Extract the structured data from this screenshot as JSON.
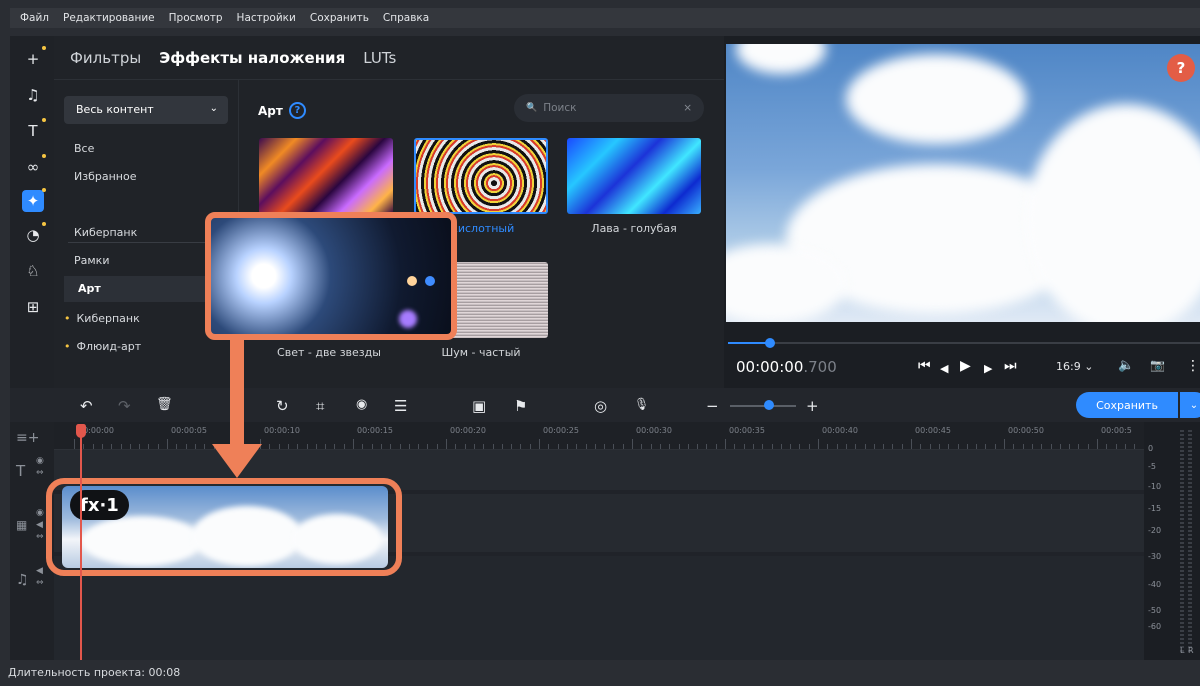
{
  "menu": [
    "Файл",
    "Редактирование",
    "Просмотр",
    "Настройки",
    "Сохранить",
    "Справка"
  ],
  "tools": [
    {
      "icon": "plus-icon",
      "glyph": "+"
    },
    {
      "icon": "music-icon",
      "glyph": "♫"
    },
    {
      "icon": "text-icon",
      "glyph": "T"
    },
    {
      "icon": "transitions-icon",
      "glyph": "∞"
    },
    {
      "icon": "effects-icon",
      "glyph": "✦"
    },
    {
      "icon": "timer-icon",
      "glyph": "◔"
    },
    {
      "icon": "stickers-icon",
      "glyph": "♘"
    },
    {
      "icon": "more-tools-icon",
      "glyph": "⊞"
    }
  ],
  "tabs": [
    "Фильтры",
    "Эффекты наложения",
    "LUTs"
  ],
  "dropdown": {
    "value": "Весь контент",
    "caret": "⌄"
  },
  "sidebar": {
    "top": [
      "Все",
      "Избранное"
    ],
    "groups": [
      "Киберпанк",
      "Рамки",
      "Арт",
      "Киберпанк",
      "Флюид-арт"
    ]
  },
  "section": {
    "title": "Арт",
    "help": "?"
  },
  "search": {
    "placeholder": "Поиск",
    "icon": "🔍",
    "clear": "×"
  },
  "thumbnails": [
    {
      "label": ""
    },
    {
      "label": "- кислотный"
    },
    {
      "label": "Лава - голубая"
    },
    {
      "label": "Свет - две звезды"
    },
    {
      "label": "Шум - частый"
    }
  ],
  "help_button": "?",
  "player": {
    "time_main": "00:00:00",
    "time_ms": ".700",
    "controls": [
      "⏮",
      "◀",
      "▶",
      "▶",
      "⏭"
    ],
    "aspect": "16:9 ⌄",
    "volume": "🔈",
    "snapshot": "📷",
    "more": "⋮",
    "progress": 0.09
  },
  "timeline_toolbar": {
    "undo": "↶",
    "redo": "↷",
    "delete": "🗑",
    "rotate": "↻",
    "crop": "⌗",
    "color": "◉",
    "adjust": "☰",
    "stabilize": "▣",
    "marker": "⚑",
    "webcam": "◎",
    "voice": "🎙",
    "zoom_minus": "−",
    "zoom_plus": "+",
    "save_label": "Сохранить",
    "save_caret": "⌄"
  },
  "ruler": [
    "00:00:00",
    "00:00:05",
    "00:00:10",
    "00:00:15",
    "00:00:20",
    "00:00:25",
    "00:00:30",
    "00:00:35",
    "00:00:40",
    "00:00:45",
    "00:00:50",
    "00:00:5"
  ],
  "clip": {
    "badge": "fx·1"
  },
  "db_scale": [
    "0",
    "-5",
    "-10",
    "-15",
    "-20",
    "-30",
    "-40",
    "-50",
    "-60"
  ],
  "meter_lr": [
    "L",
    "R"
  ],
  "status": "Длительность проекта: 00:08",
  "colors": {
    "accent": "#2f8bff",
    "highlight": "#ef8058",
    "playhead": "#e2574c"
  }
}
